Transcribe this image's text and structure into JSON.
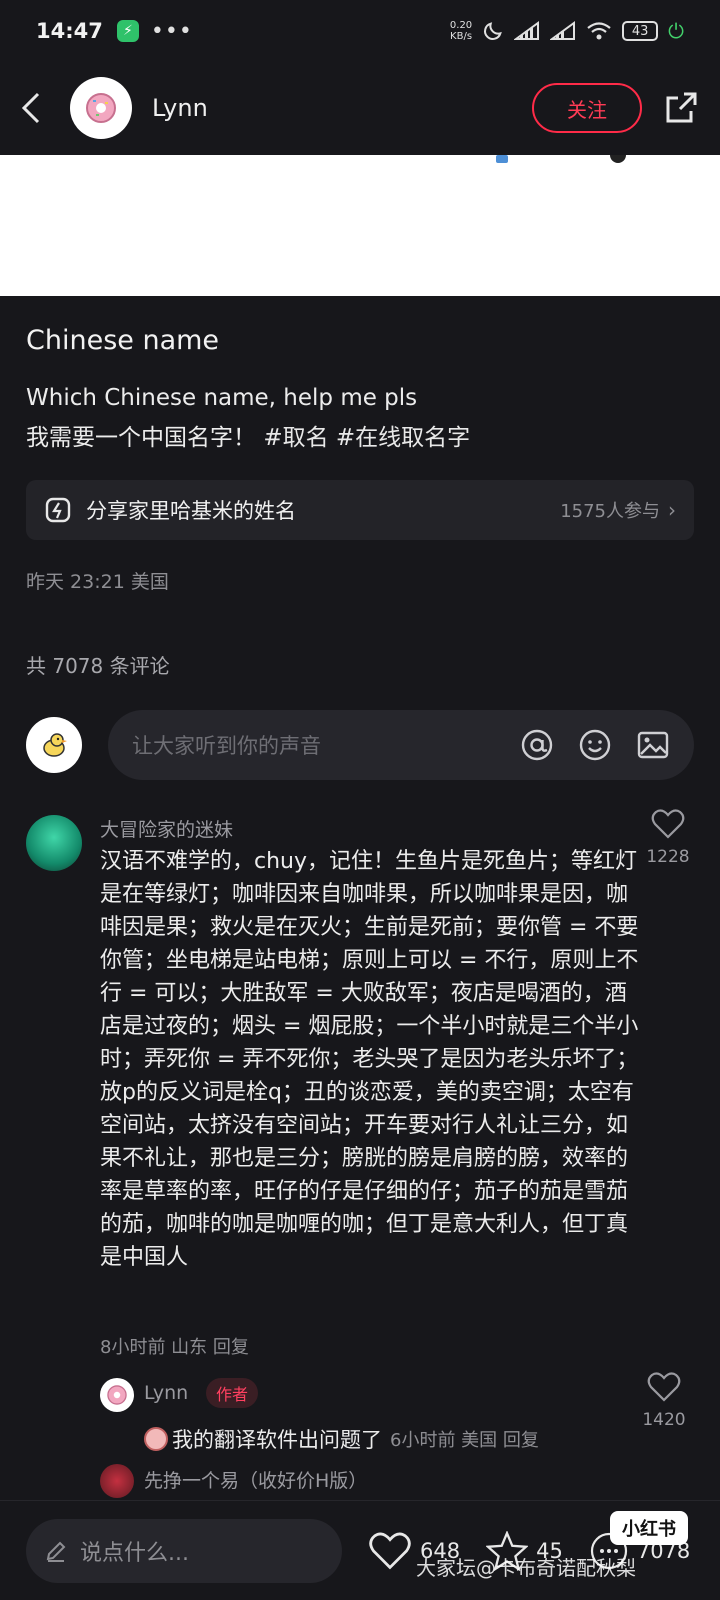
{
  "status": {
    "time": "14:47",
    "dots": "•••",
    "net_speed": "0.20",
    "net_unit": "KB/s",
    "battery": "43"
  },
  "header": {
    "author": "Lynn",
    "follow_label": "关注"
  },
  "post": {
    "title": "Chinese name",
    "line1": "Which Chinese name, help me pls",
    "line2": "我需要一个中国名字！",
    "tag1": "#取名",
    "tag2": "#在线取名字",
    "topic_title": "分享家里哈基米的姓名",
    "topic_count": "1575人参与",
    "meta": "昨天 23:21 美国"
  },
  "comments_header": "共 7078 条评论",
  "composer": {
    "placeholder": "让大家听到你的声音"
  },
  "comment": {
    "author": "大冒险家的迷妹",
    "text": "汉语不难学的，chuy，记住！生鱼片是死鱼片；等红灯是在等绿灯；咖啡因来自咖啡果，所以咖啡果是因，咖啡因是果；救火是在灭火；生前是死前；要你管 = 不要你管；坐电梯是站电梯；原则上可以 = 不行，原则上不行 = 可以；大胜敌军 = 大败敌军；夜店是喝酒的，酒店是过夜的；烟头 = 烟屁股；一个半小时就是三个半小时；弄死你 = 弄不死你；老头哭了是因为老头乐坏了；放p的反义词是栓q；丑的谈恋爱，美的卖空调；太空有空间站，太挤没有空间站；开车要对行人礼让三分，如果不礼让，那也是三分；膀胱的膀是肩膀的膀，效率的率是草率的率，旺仔的仔是仔细的仔；茄子的茄是雪茄的茄，咖啡的咖是咖喱的咖；但丁是意大利人，但丁真是中国人",
    "meta": "8小时前  山东  回复",
    "likes": "1228"
  },
  "reply": {
    "author": "Lynn",
    "badge": "作者",
    "text": "我的翻译软件出问题了",
    "meta": "6小时前  美国  回复",
    "likes": "1420"
  },
  "reply2": {
    "author": "先挣一个易（收好价H版）"
  },
  "bottom": {
    "say_placeholder": "说点什么...",
    "likes": "648",
    "stars": "45",
    "comments": "7078"
  },
  "watermark": {
    "badge": "小红书",
    "text": "大家坛@卡布奇诺配秋梨"
  },
  "colors": {
    "background": "#17171b",
    "accent": "#ff2b48",
    "muted": "#8e8e93"
  },
  "icons": [
    "back-arrow-icon",
    "share-icon",
    "topic-icon",
    "at-icon",
    "emoji-icon",
    "image-icon",
    "heart-icon",
    "star-icon",
    "comment-icon",
    "pencil-icon"
  ]
}
